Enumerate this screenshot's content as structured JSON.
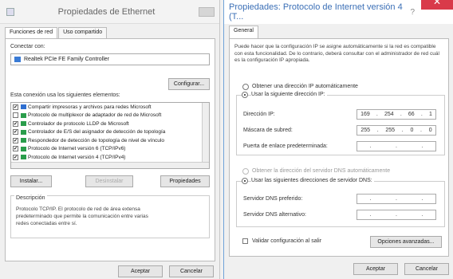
{
  "left": {
    "title": "Propiedades de Ethernet",
    "tabs": [
      "Funciones de red",
      "Uso compartido"
    ],
    "connect_using_label": "Conectar con:",
    "adapter_name": "Realtek PCIe FE Family Controller",
    "configure_button": "Configurar...",
    "items_label": "Esta conexión usa los siguientes elementos:",
    "items": [
      {
        "label": "Compartir impresoras y archivos para redes Microsoft",
        "checked": "✔"
      },
      {
        "label": "Protocolo de multiplexor de adaptador de red de Microsoft",
        "checked": ""
      },
      {
        "label": "Controlador de protocolo LLDP de Microsoft",
        "checked": "✔"
      },
      {
        "label": "Controlador de E/S del asignador de detección de topología",
        "checked": "✔"
      },
      {
        "label": "Respondedor de detección de topología de nivel de vínculo",
        "checked": "✔"
      },
      {
        "label": "Protocolo de Internet versión 6 (TCP/IPv6)",
        "checked": "✔"
      },
      {
        "label": "Protocolo de Internet versión 4 (TCP/IPv4)",
        "checked": "✔"
      }
    ],
    "install_button": "Instalar...",
    "uninstall_button": "Desinstalar",
    "properties_button": "Propiedades",
    "description_label": "Descripción",
    "description_text": "Protocolo TCP/IP. El protocolo de red de área extensa predeterminado que permite la comunicación entre varias redes conectadas entre sí.",
    "accept_button": "Aceptar",
    "cancel_button": "Cancelar"
  },
  "right": {
    "title": "Propiedades: Protocolo de Internet versión 4 (T...",
    "help_glyph": "?",
    "close_glyph": "✕",
    "tab": "General",
    "intro_text": "Puede hacer que la configuración IP se asigne automáticamente si la red es compatible con esta funcionalidad. De lo contrario, deberá consultar con el administrador de red cuál es la configuración IP apropiada.",
    "auto_ip_label": "Obtener una dirección IP automáticamente",
    "manual_ip_label": "Usar la siguiente dirección IP:",
    "ip_label": "Dirección IP:",
    "ip_value": [
      "169",
      "254",
      "66",
      "1"
    ],
    "mask_label": "Máscara de subred:",
    "mask_value": [
      "255",
      "255",
      "0",
      "0"
    ],
    "gateway_label": "Puerta de enlace predeterminada:",
    "auto_dns_label": "Obtener la dirección del servidor DNS automáticamente",
    "manual_dns_label": "Usar las siguientes direcciones de servidor DNS:",
    "preferred_dns_label": "Servidor DNS preferido:",
    "alternate_dns_label": "Servidor DNS alternativo:",
    "validate_label": "Validar configuración al salir",
    "advanced_button": "Opciones avanzadas...",
    "accept_button": "Aceptar",
    "cancel_button": "Cancelar"
  },
  "colors": {
    "close": "#d93a4a",
    "title_right": "#3b6fb6"
  }
}
